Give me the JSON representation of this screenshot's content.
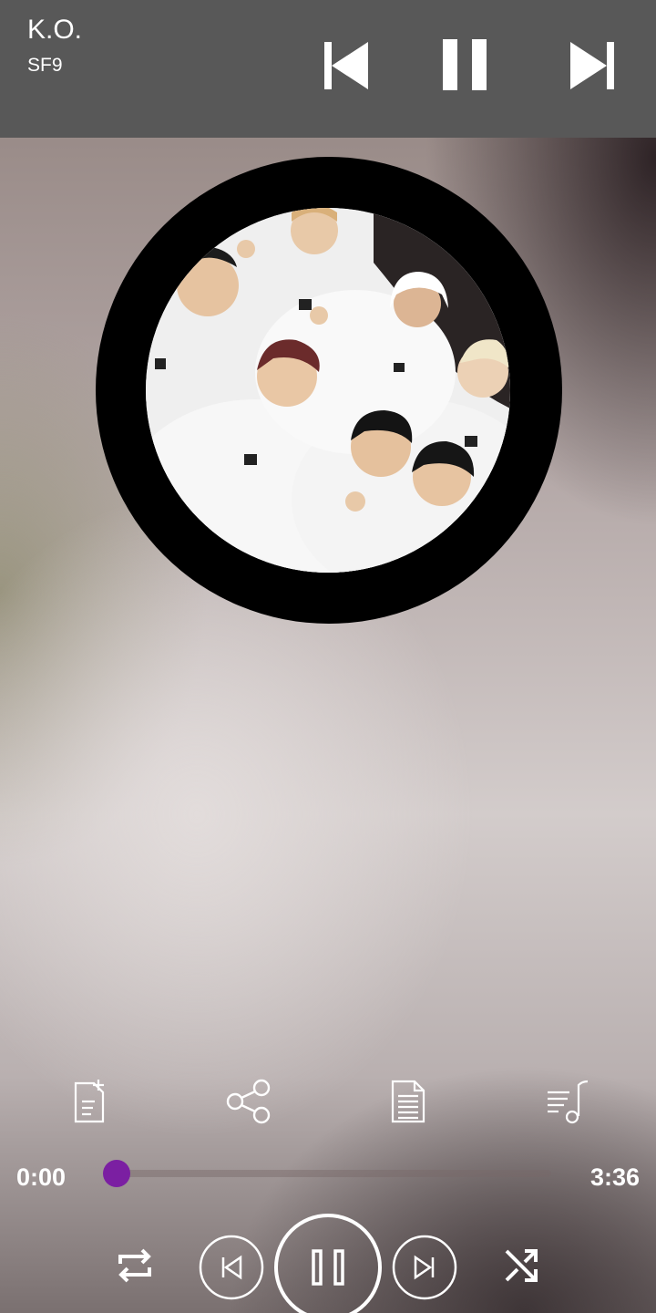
{
  "mini_player": {
    "title": "K.O.",
    "artist": "SF9",
    "icons": {
      "previous": "skip-previous-icon",
      "pause": "pause-icon",
      "next": "skip-next-icon"
    }
  },
  "album_art": {
    "description_icon": "album-cover-image"
  },
  "actions": [
    {
      "id": "add-to-playlist",
      "icon": "playlist-add-icon"
    },
    {
      "id": "share",
      "icon": "share-icon"
    },
    {
      "id": "lyrics",
      "icon": "lyrics-document-icon"
    },
    {
      "id": "queue",
      "icon": "music-queue-icon"
    }
  ],
  "progress": {
    "current_time": "0:00",
    "total_time": "3:36",
    "fraction": 0.0
  },
  "controls": {
    "repeat_icon": "repeat-icon",
    "previous_icon": "skip-previous-icon",
    "play_pause_icon": "pause-icon",
    "next_icon": "skip-next-icon",
    "shuffle_icon": "shuffle-icon"
  },
  "colors": {
    "accent": "#7b1fa2",
    "topbar": "#585858",
    "icon": "#ffffff"
  }
}
